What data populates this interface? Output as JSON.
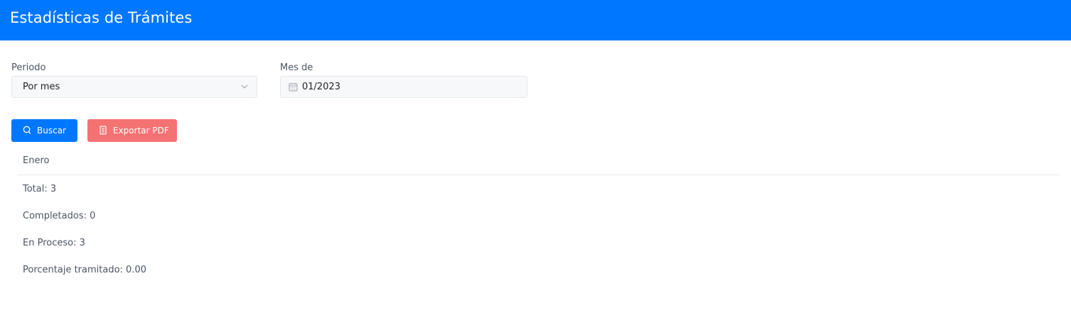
{
  "header": {
    "title": "Estadísticas de Trámites"
  },
  "filters": {
    "period": {
      "label": "Periodo",
      "value": "Por mes"
    },
    "month": {
      "label": "Mes de",
      "value": "01/2023"
    }
  },
  "actions": {
    "search_label": "Buscar",
    "export_label": "Exportar PDF"
  },
  "results": {
    "heading": "Enero",
    "total": "Total: 3",
    "completed": "Completados: 0",
    "in_process": "En Proceso: 3",
    "percentage": "Porcentaje tramitado: 0.00"
  },
  "colors": {
    "primary": "#0077ff",
    "danger": "#f57272",
    "text": "#4b5563"
  },
  "icons": {
    "chevron": "chevron-down-icon",
    "calendar": "calendar-icon",
    "search": "search-icon",
    "pdf": "document-icon"
  }
}
